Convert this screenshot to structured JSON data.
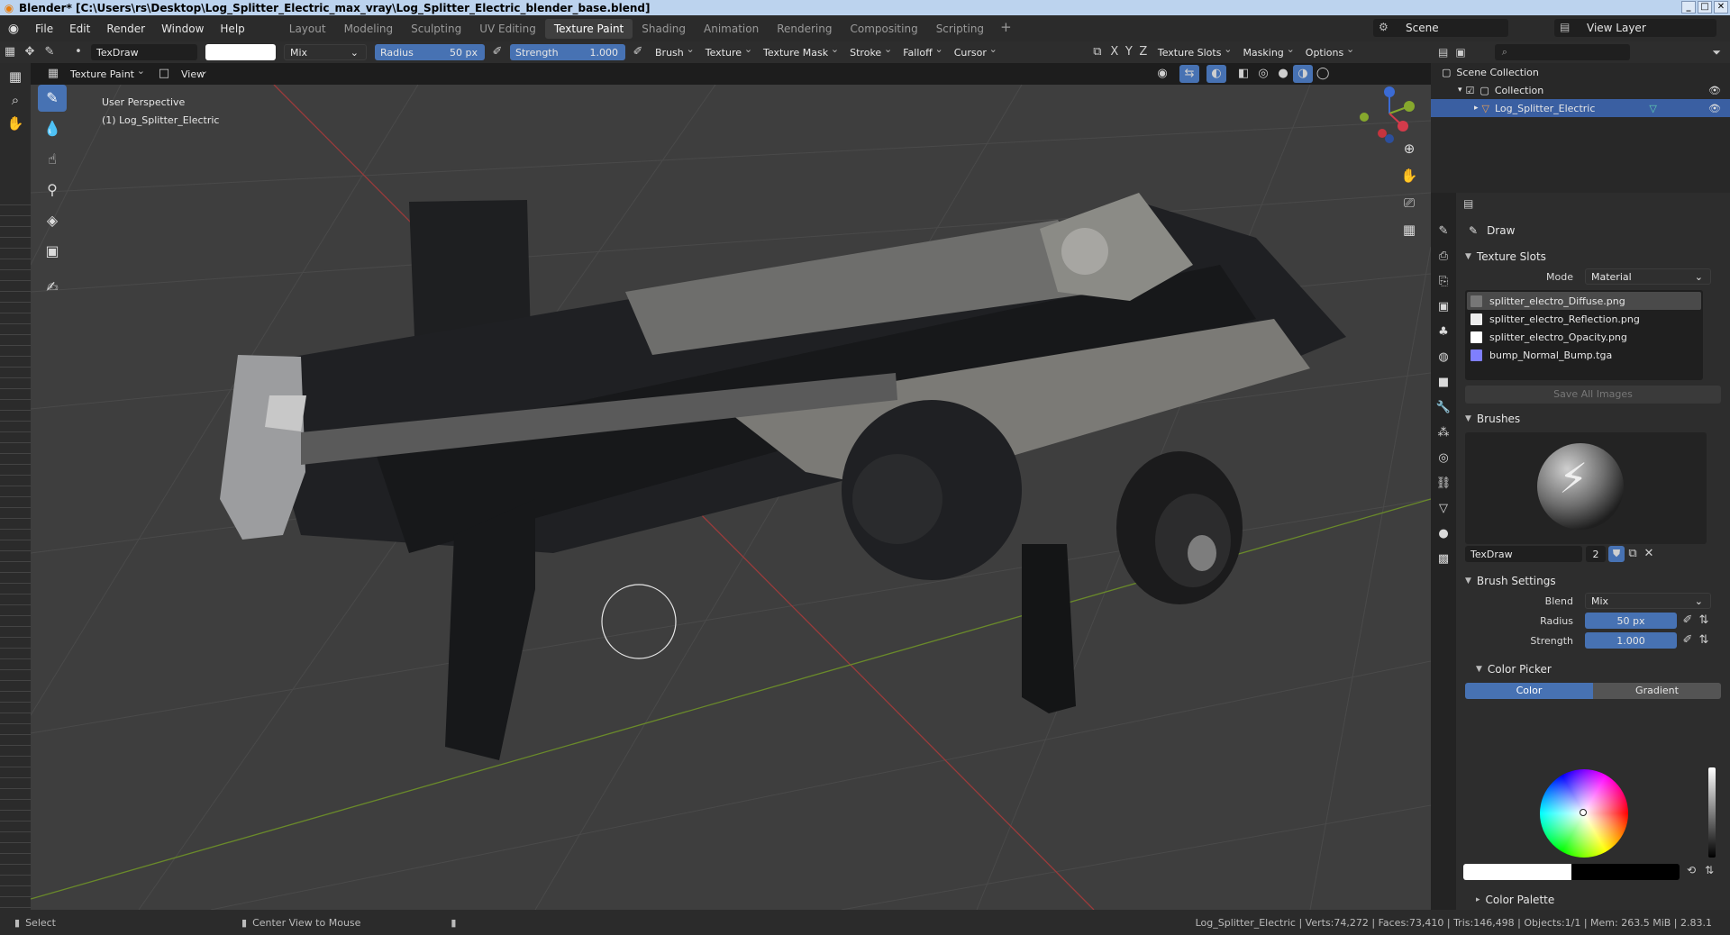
{
  "window": {
    "title": "Blender* [C:\\Users\\rs\\Desktop\\Log_Splitter_Electric_max_vray\\Log_Splitter_Electric_blender_base.blend]"
  },
  "menu": {
    "items": [
      "File",
      "Edit",
      "Render",
      "Window",
      "Help"
    ],
    "workspaces": [
      "Layout",
      "Modeling",
      "Sculpting",
      "UV Editing",
      "Texture Paint",
      "Shading",
      "Animation",
      "Rendering",
      "Compositing",
      "Scripting"
    ],
    "active_workspace": "Texture Paint",
    "plus": "+",
    "scene": "Scene",
    "view_layer": "View Layer"
  },
  "tool_header": {
    "brush_name": "TexDraw",
    "blend_mode": "Mix",
    "radius_label": "Radius",
    "radius_value": "50 px",
    "strength_label": "Strength",
    "strength_value": "1.000",
    "dropdowns": [
      "Brush",
      "Texture",
      "Texture Mask",
      "Stroke",
      "Falloff",
      "Cursor"
    ],
    "axes": [
      "X",
      "Y",
      "Z"
    ],
    "right_dropdowns": [
      "Texture Slots",
      "Masking",
      "Options"
    ]
  },
  "view_header": {
    "mode": "Texture Paint",
    "view": "View"
  },
  "viewport": {
    "perspective": "User Perspective",
    "object_label": "(1) Log_Splitter_Electric"
  },
  "outliner": {
    "scene_collection": "Scene Collection",
    "collection": "Collection",
    "object": "Log_Splitter_Electric"
  },
  "properties": {
    "tool_title": "Draw",
    "texture_slots_title": "Texture Slots",
    "mode_label": "Mode",
    "mode_value": "Material",
    "slots": [
      {
        "name": "splitter_electro_Diffuse.png",
        "color": "#777777"
      },
      {
        "name": "splitter_electro_Reflection.png",
        "color": "#eeeeee"
      },
      {
        "name": "splitter_electro_Opacity.png",
        "color": "#ffffff"
      },
      {
        "name": "bump_Normal_Bump.tga",
        "color": "#7f7fff"
      }
    ],
    "save_all": "Save All Images",
    "brushes_title": "Brushes",
    "brush_name": "TexDraw",
    "brush_users": "2",
    "brush_settings_title": "Brush Settings",
    "blend_label": "Blend",
    "blend_value": "Mix",
    "radius_label": "Radius",
    "radius_value": "50 px",
    "strength_label": "Strength",
    "strength_value": "1.000",
    "color_picker_title": "Color Picker",
    "color_tab": "Color",
    "gradient_tab": "Gradient",
    "color_palette_title": "Color Palette"
  },
  "statusbar": {
    "select": "Select",
    "center_view": "Center View to Mouse",
    "stats": "Log_Splitter_Electric | Verts:74,272 | Faces:73,410 | Tris:146,498 | Objects:1/1 | Mem: 263.5 MiB | 2.83.1"
  }
}
